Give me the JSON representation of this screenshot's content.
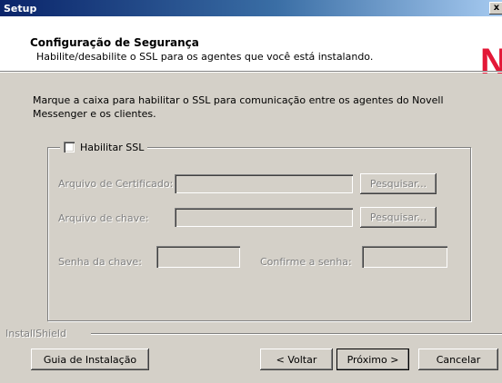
{
  "window": {
    "title": "Setup",
    "close_glyph": "x"
  },
  "header": {
    "title": "Configuração de Segurança",
    "subtitle": "Habilite/desabilite o SSL para os agentes que você está instalando.",
    "logo_text": "N",
    "logo_color": "#e31837"
  },
  "description": "Marque a caixa para habilitar o SSL para comunicação entre os agentes do Novell Messenger e os clientes.",
  "ssl_group": {
    "checkbox_label": "Habilitar SSL",
    "checked": false,
    "certificate_label": "Arquivo de Certificado:",
    "certificate_value": "",
    "key_label": "Arquivo de chave:",
    "key_value": "",
    "browse_label": "Pesquisar...",
    "password_label": "Senha da chave:",
    "password_value": "",
    "confirm_label": "Confirme a senha:",
    "confirm_value": ""
  },
  "footer": {
    "installshield_label": "InstallShield",
    "guide_button": "Guia de Instalação",
    "back_button": "< Voltar",
    "next_button": "Próximo >",
    "cancel_button": "Cancelar"
  }
}
